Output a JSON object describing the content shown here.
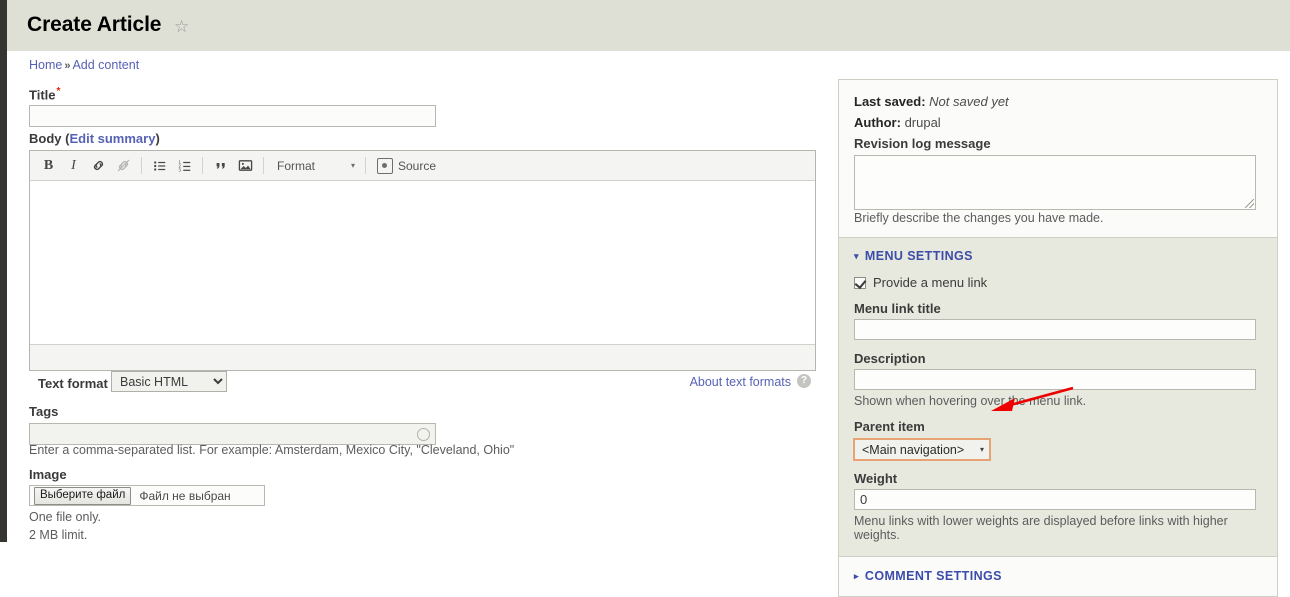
{
  "header": {
    "title": "Create Article",
    "star_icon": "star-outline-icon"
  },
  "breadcrumb": {
    "home": "Home",
    "separator": "»",
    "current": "Add content"
  },
  "form": {
    "title_field": {
      "label": "Title",
      "required_mark": "*",
      "value": "",
      "placeholder": ""
    },
    "body_field": {
      "label": "Body",
      "edit_summary_link": "Edit summary",
      "open_paren": "(",
      "close_paren": ")",
      "value": ""
    },
    "editor_toolbar": {
      "bold": "B",
      "italic": "I",
      "link_icon": "link-icon",
      "unlink_icon": "unlink-icon",
      "bullet_list_icon": "bulleted-list-icon",
      "numbered_list_icon": "numbered-list-icon",
      "blockquote": "”",
      "image_icon": "image-icon",
      "format_label": "Format",
      "format_carat": "▾",
      "source_label": "Source"
    },
    "text_format": {
      "label": "Text format",
      "selected": "Basic HTML",
      "options": [
        "Basic HTML"
      ],
      "about_link": "About text formats",
      "help_icon": "?"
    },
    "tags_field": {
      "label": "Tags",
      "value": "",
      "description": "Enter a comma-separated list. For example: Amsterdam, Mexico City, \"Cleveland, Ohio\"",
      "throbber_icon": "autocomplete-throbber-icon"
    },
    "image_field": {
      "label": "Image",
      "button_label": "Выберите файл",
      "status_text": "Файл не выбран",
      "description_1": "One file only.",
      "description_2": "2 MB limit."
    }
  },
  "sidebar": {
    "meta": {
      "last_saved_label": "Last saved:",
      "last_saved_value": "Not saved yet",
      "author_label": "Author:",
      "author_value": "drupal",
      "revision_log_label": "Revision log message",
      "revision_log_value": "",
      "revision_log_description": "Briefly describe the changes you have made."
    },
    "menu_settings": {
      "summary": "MENU SETTINGS",
      "triangle": "▾",
      "expanded": true,
      "provide_menu_link_label": "Provide a menu link",
      "provide_menu_link_checked": true,
      "menu_link_title_label": "Menu link title",
      "menu_link_title_value": "",
      "description_label": "Description",
      "description_value": "",
      "description_help": "Shown when hovering over the menu link.",
      "parent_item_label": "Parent item",
      "parent_item_selected": "<Main navigation>",
      "parent_item_carat": "▾",
      "parent_item_options": [
        "<Main navigation>"
      ],
      "weight_label": "Weight",
      "weight_value": "0",
      "weight_help": "Menu links with lower weights are displayed before links with higher weights."
    },
    "comment_settings": {
      "summary": "COMMENT SETTINGS",
      "triangle": "▸",
      "expanded": false
    }
  },
  "annotation": {
    "arrow_color": "#ee0000",
    "arrow_name": "red-pointer-arrow"
  },
  "colors": {
    "header_bg": "#dee0d6",
    "link": "#5762b5",
    "section_title": "#3b4caa",
    "required": "#e32700",
    "focus_outline": "#e7a373",
    "sidebar_section_bg": "#e7e9de"
  }
}
